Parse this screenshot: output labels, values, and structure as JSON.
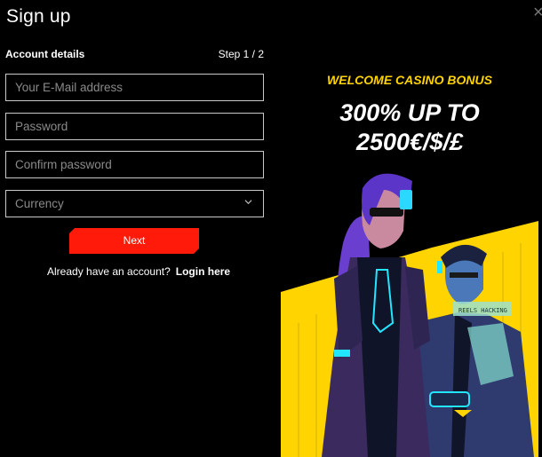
{
  "modal": {
    "title": "Sign up",
    "close_glyph": "×"
  },
  "form": {
    "section_label": "Account details",
    "step": "Step 1 / 2",
    "email_placeholder": "Your E-Mail address",
    "password_placeholder": "Password",
    "confirm_placeholder": "Confirm password",
    "currency_label": "Currency",
    "next_label": "Next",
    "login_prompt": "Already have an account?",
    "login_link": "Login here"
  },
  "promo": {
    "headline": "WELCOME CASINO BONUS",
    "offer_line1": "300% UP TO",
    "offer_line2": "2500€/$/£",
    "sign_text": "REELS HACKING",
    "colors": {
      "accent": "#ffd400",
      "button": "#ff1a0a",
      "background": "#000000"
    }
  }
}
